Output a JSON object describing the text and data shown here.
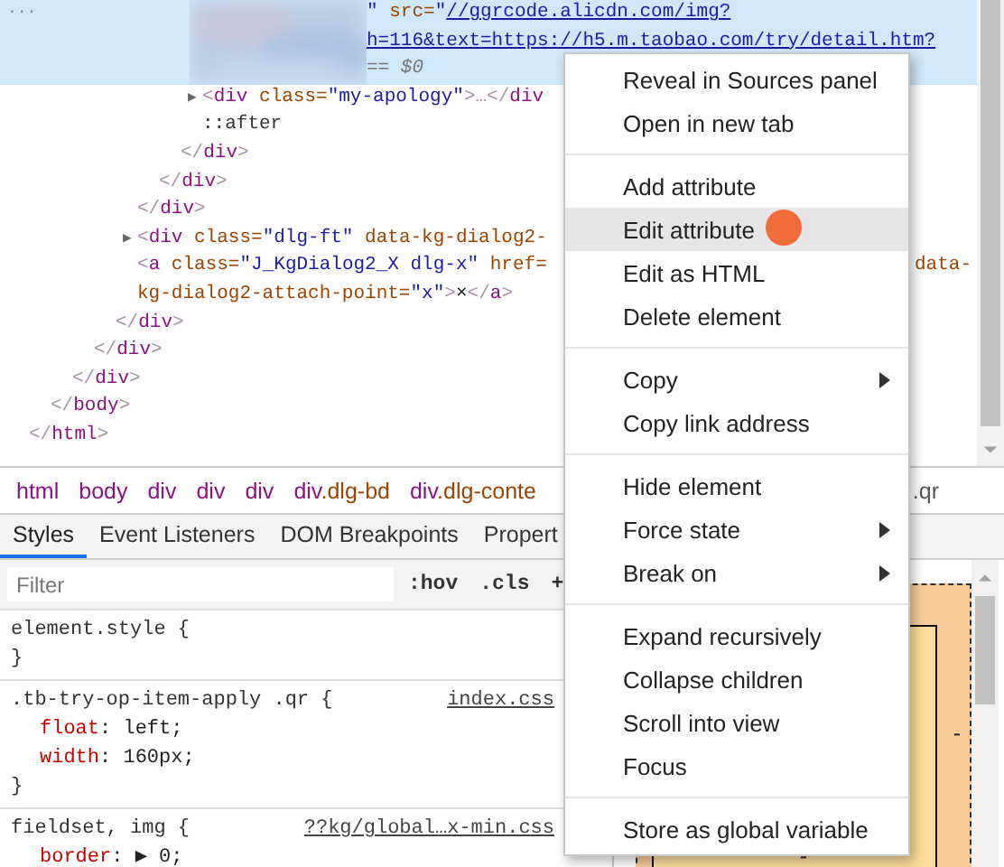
{
  "dom_tree": {
    "root": {
      "selected": false,
      "close": [
        {
          "kind": "punct",
          "text": "</"
        },
        {
          "kind": "tag",
          "text": "html"
        },
        {
          "kind": "punct",
          "text": ">"
        }
      ],
      "children": [
        {
          "selected": false,
          "close": [
            {
              "kind": "punct",
              "text": "</"
            },
            {
              "kind": "tag",
              "text": "body"
            },
            {
              "kind": "punct",
              "text": ">"
            }
          ],
          "children": [
            {
              "selected": false,
              "close": [
                {
                  "kind": "punct",
                  "text": "</"
                },
                {
                  "kind": "tag",
                  "text": "div"
                },
                {
                  "kind": "punct",
                  "text": ">"
                }
              ],
              "children": [
                {
                  "selected": false,
                  "close": [
                    {
                      "kind": "punct",
                      "text": "</"
                    },
                    {
                      "kind": "tag",
                      "text": "div"
                    },
                    {
                      "kind": "punct",
                      "text": ">"
                    }
                  ],
                  "children": [
                    {
                      "selected": false,
                      "close": [
                        {
                          "kind": "punct",
                          "text": "</"
                        },
                        {
                          "kind": "tag",
                          "text": "div"
                        },
                        {
                          "kind": "punct",
                          "text": ">"
                        }
                      ],
                      "children": [
                        {
                          "selected": false,
                          "close": [
                            {
                              "kind": "punct",
                              "text": "</"
                            },
                            {
                              "kind": "tag",
                              "text": "div"
                            },
                            {
                              "kind": "punct",
                              "text": ">"
                            }
                          ],
                          "children": [
                            {
                              "selected": false,
                              "close": [
                                {
                                  "kind": "punct",
                                  "text": "</"
                                },
                                {
                                  "kind": "tag",
                                  "text": "div"
                                },
                                {
                                  "kind": "punct",
                                  "text": ">"
                                }
                              ],
                              "children": [
                                {
                                  "selected": false,
                                  "close": [
                                    {
                                      "kind": "punct",
                                      "text": "</"
                                    },
                                    {
                                      "kind": "tag",
                                      "text": "div"
                                    },
                                    {
                                      "kind": "punct",
                                      "text": ">"
                                    }
                                  ],
                                  "children": [
                                    {
                                      "selected": true,
                                      "blurred": true,
                                      "gutter": "...",
                                      "lines": [
                                        {
                                          "tokens": [
                                            {
                                              "kind": "value",
                                              "text": "\""
                                            },
                                            {
                                              "kind": "attr",
                                              "text": " src="
                                            },
                                            {
                                              "kind": "value",
                                              "text": "\""
                                            },
                                            {
                                              "kind": "link",
                                              "text": "//ggrcode.alicdn.com/img?"
                                            }
                                          ]
                                        },
                                        {
                                          "tokens": [
                                            {
                                              "kind": "link",
                                              "text": "h=116&text=https://h5.m.taobao.com/try/detail.htm?"
                                            }
                                          ]
                                        },
                                        {
                                          "tokens": [
                                            {
                                              "kind": "hint",
                                              "text": "== $0"
                                            }
                                          ]
                                        }
                                      ]
                                    },
                                    {
                                      "selected": false,
                                      "lines": [
                                        {
                                          "tokens": [
                                            {
                                              "kind": "arrow",
                                              "text": "▶"
                                            },
                                            {
                                              "kind": "punct",
                                              "text": "<"
                                            },
                                            {
                                              "kind": "tag",
                                              "text": "div"
                                            },
                                            {
                                              "kind": "attr",
                                              "text": " class="
                                            },
                                            {
                                              "kind": "value",
                                              "text": "\"my-apology\""
                                            },
                                            {
                                              "kind": "punct",
                                              "text": ">…</"
                                            },
                                            {
                                              "kind": "tag",
                                              "text": "div"
                                            }
                                          ]
                                        }
                                      ]
                                    },
                                    {
                                      "selected": false,
                                      "lines": [
                                        {
                                          "tokens": [
                                            {
                                              "kind": "pseudo",
                                              "text": "::after"
                                            }
                                          ]
                                        }
                                      ]
                                    }
                                  ]
                                }
                              ]
                            }
                          ]
                        },
                        {
                          "selected": false,
                          "lines": [
                            {
                              "tokens": [
                                {
                                  "kind": "arrow",
                                  "text": "▶"
                                },
                                {
                                  "kind": "punct",
                                  "text": "<"
                                },
                                {
                                  "kind": "tag",
                                  "text": "div"
                                },
                                {
                                  "kind": "attr",
                                  "text": " class="
                                },
                                {
                                  "kind": "value",
                                  "text": "\"dlg-ft\""
                                },
                                {
                                  "kind": "attr",
                                  "text": " data-kg-dialog2-"
                                }
                              ]
                            }
                          ]
                        },
                        {
                          "selected": false,
                          "lines": [
                            {
                              "tokens": [
                                {
                                  "kind": "punct",
                                  "text": "<"
                                },
                                {
                                  "kind": "tag",
                                  "text": "a"
                                },
                                {
                                  "kind": "attr",
                                  "text": " class="
                                },
                                {
                                  "kind": "value",
                                  "text": "\"J_KgDialog2_X dlg-x\""
                                },
                                {
                                  "kind": "attr",
                                  "text": " href="
                                }
                              ],
                              "tail": [
                                {
                                  "kind": "attr",
                                  "text": "data-"
                                }
                              ]
                            },
                            {
                              "tokens": [
                                {
                                  "kind": "attr",
                                  "text": "kg-dialog2-attach-point="
                                },
                                {
                                  "kind": "value",
                                  "text": "\"x\""
                                },
                                {
                                  "kind": "punct",
                                  "text": ">"
                                },
                                {
                                  "kind": "text",
                                  "text": "×"
                                },
                                {
                                  "kind": "punct",
                                  "text": "</"
                                },
                                {
                                  "kind": "tag",
                                  "text": "a"
                                },
                                {
                                  "kind": "punct",
                                  "text": ">"
                                }
                              ]
                            }
                          ]
                        }
                      ]
                    }
                  ]
                }
              ]
            }
          ]
        }
      ]
    }
  },
  "breadcrumbs": {
    "items": [
      {
        "tag": "html"
      },
      {
        "tag": "body"
      },
      {
        "tag": "div"
      },
      {
        "tag": "div"
      },
      {
        "tag": "div"
      },
      {
        "tag": "div",
        "cls": ".dlg-bd"
      },
      {
        "tag": "div",
        "cls": ".dlg-conte"
      }
    ],
    "tail": ".qr"
  },
  "tabs": [
    {
      "label": "Styles",
      "selected": true
    },
    {
      "label": "Event Listeners",
      "selected": false
    },
    {
      "label": "DOM Breakpoints",
      "selected": false
    },
    {
      "label": "Propert",
      "selected": false
    }
  ],
  "styles_pane": {
    "filter": {
      "placeholder": "Filter"
    },
    "toolbar": [
      ":hov",
      ".cls",
      "+"
    ],
    "rules": [
      {
        "selector": "element.style {",
        "close": "}"
      },
      {
        "selector": ".tb-try-op-item-apply .qr {",
        "source": "index.css",
        "declarations": [
          {
            "property": "float",
            "colon": ":",
            "value": " left;"
          },
          {
            "property": "width",
            "colon": ":",
            "value": " 160px;"
          }
        ],
        "close": "}"
      },
      {
        "selector": "fieldset, img {",
        "source": "??kg/global…x-min.css",
        "declarations": [
          {
            "property": "border",
            "colon": ":",
            "value": " ▶ 0;"
          }
        ]
      }
    ]
  },
  "box_model": {
    "margin_right": "-",
    "margin_bottom": "-"
  },
  "context_menu": {
    "groups": [
      [
        {
          "label": "Reveal in Sources panel",
          "submenu": false,
          "selected": false
        },
        {
          "label": "Open in new tab",
          "submenu": false,
          "selected": false
        }
      ],
      [
        {
          "label": "Add attribute",
          "submenu": false,
          "selected": false
        },
        {
          "label": "Edit attribute",
          "submenu": false,
          "selected": true
        },
        {
          "label": "Edit as HTML",
          "submenu": false,
          "selected": false
        },
        {
          "label": "Delete element",
          "submenu": false,
          "selected": false
        }
      ],
      [
        {
          "label": "Copy",
          "submenu": true,
          "selected": false
        },
        {
          "label": "Copy link address",
          "submenu": false,
          "selected": false
        }
      ],
      [
        {
          "label": "Hide element",
          "submenu": false,
          "selected": false
        },
        {
          "label": "Force state",
          "submenu": true,
          "selected": false
        },
        {
          "label": "Break on",
          "submenu": true,
          "selected": false
        }
      ],
      [
        {
          "label": "Expand recursively",
          "submenu": false,
          "selected": false
        },
        {
          "label": "Collapse children",
          "submenu": false,
          "selected": false
        },
        {
          "label": "Scroll into view",
          "submenu": false,
          "selected": false
        },
        {
          "label": "Focus",
          "submenu": false,
          "selected": false
        }
      ],
      [
        {
          "label": "Store as global variable",
          "submenu": false,
          "selected": false
        }
      ]
    ]
  }
}
